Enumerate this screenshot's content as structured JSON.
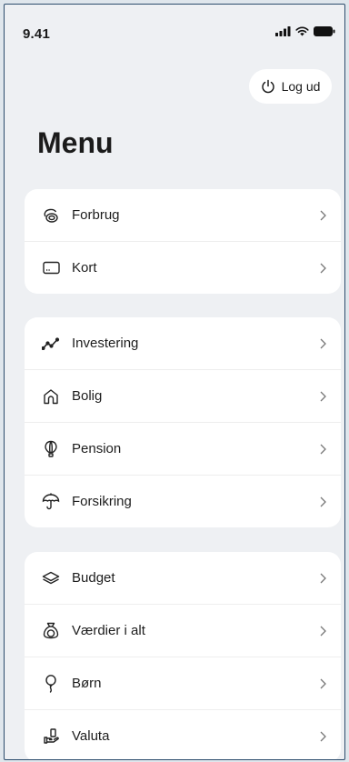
{
  "status": {
    "time": "9.41"
  },
  "header": {
    "logout_label": "Log ud",
    "title": "Menu"
  },
  "groups": [
    {
      "items": [
        {
          "label": "Forbrug",
          "icon": "coins-icon"
        },
        {
          "label": "Kort",
          "icon": "card-icon"
        }
      ]
    },
    {
      "items": [
        {
          "label": "Investering",
          "icon": "trend-icon"
        },
        {
          "label": "Bolig",
          "icon": "house-icon"
        },
        {
          "label": "Pension",
          "icon": "balloon-icon"
        },
        {
          "label": "Forsikring",
          "icon": "umbrella-icon"
        }
      ]
    },
    {
      "items": [
        {
          "label": "Budget",
          "icon": "layers-icon"
        },
        {
          "label": "Værdier i alt",
          "icon": "money-bag-icon"
        },
        {
          "label": "Børn",
          "icon": "party-balloon-icon"
        },
        {
          "label": "Valuta",
          "icon": "exchange-icon"
        }
      ]
    }
  ]
}
